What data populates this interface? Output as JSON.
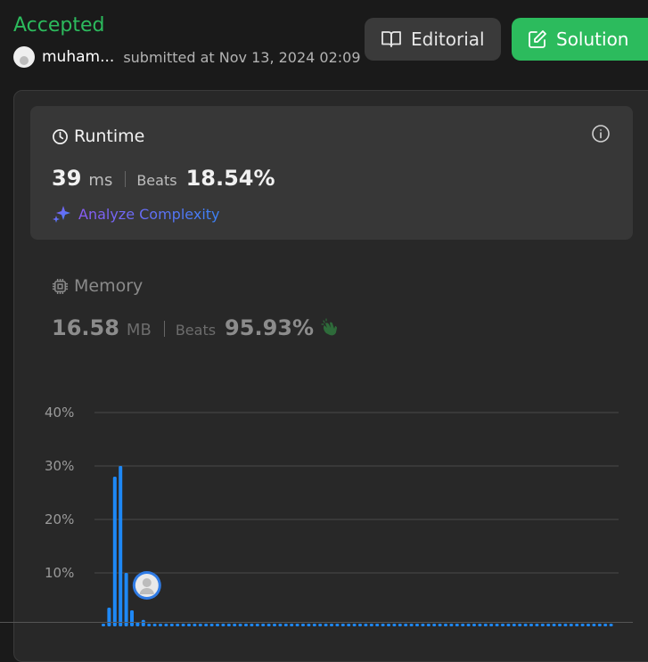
{
  "header": {
    "status": "Accepted",
    "username": "muham...",
    "submitted_text": "submitted at Nov 13, 2024 02:09",
    "editorial_label": "Editorial",
    "solution_label": "Solution"
  },
  "runtime": {
    "label": "Runtime",
    "value": "39",
    "unit": "ms",
    "beats_label": "Beats",
    "beats_value": "18.54%",
    "analyze_label": "Analyze Complexity"
  },
  "memory": {
    "label": "Memory",
    "value": "16.58",
    "unit": "MB",
    "beats_label": "Beats",
    "beats_value": "95.93%"
  },
  "colors": {
    "accepted": "#2cbb5d",
    "bar": "#1e88f5",
    "solution_button": "#2cbb5d"
  },
  "chart_data": {
    "type": "bar",
    "y_ticks": [
      "40%",
      "30%",
      "20%",
      "10%"
    ],
    "ylim": [
      0,
      40
    ],
    "values": [
      0.5,
      3.5,
      28,
      30,
      10,
      3,
      0.8,
      1.2,
      0.5,
      0.5,
      0.5,
      0.5,
      0.5,
      0.5,
      0.5,
      0.5,
      0.5,
      0.5,
      0.5,
      0.5,
      0.5,
      0.5,
      0.5,
      0.5,
      0.5,
      0.5,
      0.5,
      0.5,
      0.5,
      0.5,
      0.5,
      0.5,
      0.5,
      0.5,
      0.5,
      0.5,
      0.5,
      0.5,
      0.5,
      0.5,
      0.5,
      0.5,
      0.5,
      0.5,
      0.5,
      0.5,
      0.5,
      0.5,
      0.5,
      0.5,
      0.5,
      0.5,
      0.5,
      0.5,
      0.5,
      0.5,
      0.5,
      0.5,
      0.5,
      0.5,
      0.5,
      0.5,
      0.5,
      0.5,
      0.5,
      0.5,
      0.5,
      0.5,
      0.5,
      0.5,
      0.5,
      0.5,
      0.5,
      0.5,
      0.5,
      0.5,
      0.5,
      0.5,
      0.5,
      0.5,
      0.5,
      0.5,
      0.5,
      0.5,
      0.5,
      0.5,
      0.5,
      0.5,
      0.5,
      0.5,
      0.5,
      0.5,
      0.5
    ],
    "marker_index": 7,
    "grid": true
  }
}
